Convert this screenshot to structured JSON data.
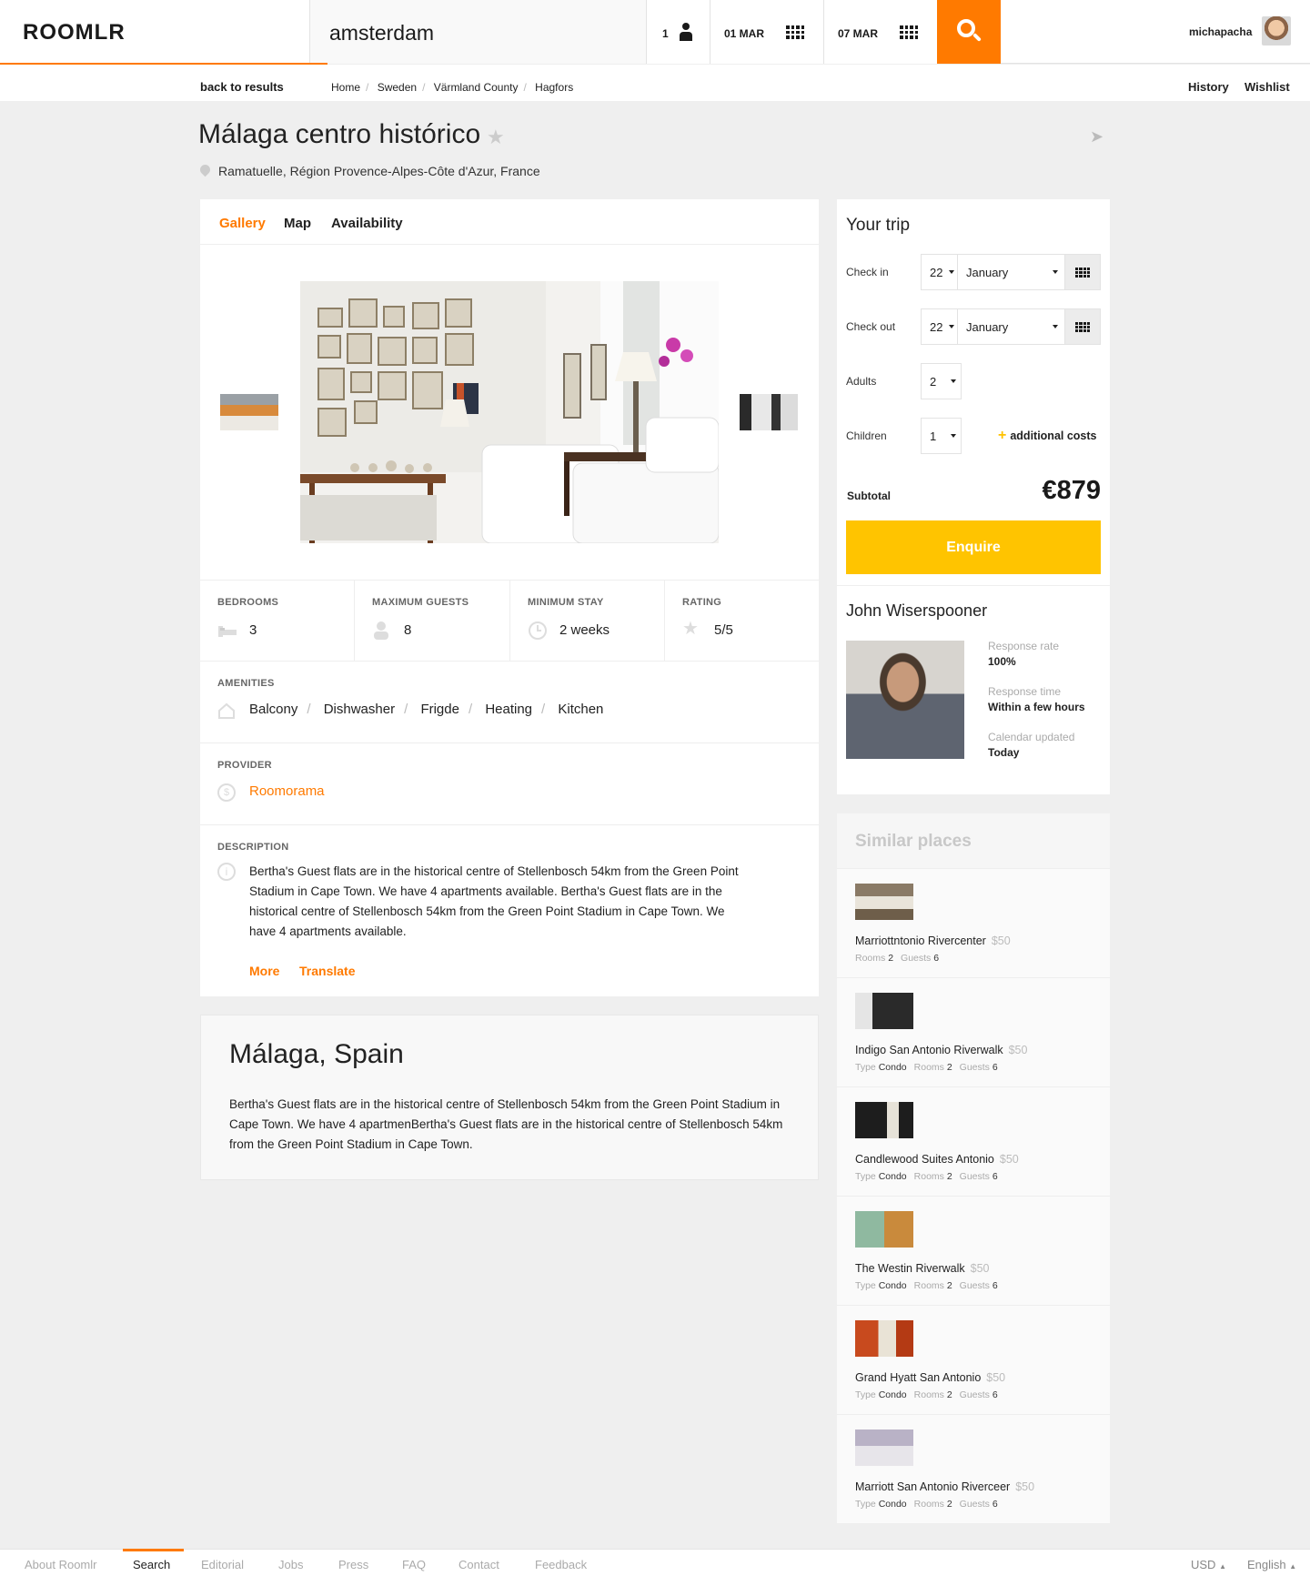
{
  "header": {
    "logo": "ROOMLR",
    "search_value": "amsterdam",
    "guests": "1",
    "checkin": "01 MAR",
    "checkout": "07 MAR",
    "username": "michapacha"
  },
  "subnav": {
    "back": "back to results",
    "breadcrumb": [
      "Home",
      "Sweden",
      "Värmland County",
      "Hagfors"
    ],
    "history": "History",
    "wishlist": "Wishlist"
  },
  "listing": {
    "title": "Málaga centro histórico",
    "location": "Ramatuelle, Région Provence-Alpes-Côte d'Azur, France",
    "tabs": [
      "Gallery",
      "Map",
      "Availability"
    ],
    "stats": [
      {
        "label": "BEDROOMS",
        "value": "3"
      },
      {
        "label": "MAXIMUM GUESTS",
        "value": "8"
      },
      {
        "label": "MINIMUM STAY",
        "value": "2 weeks"
      },
      {
        "label": "RATING",
        "value": "5/5"
      }
    ],
    "amenities_label": "AMENITIES",
    "amenities": [
      "Balcony",
      "Dishwasher",
      "Frigde",
      "Heating",
      "Kitchen"
    ],
    "provider_label": "PROVIDER",
    "provider": "Roomorama",
    "description_label": "DESCRIPTION",
    "description": "Bertha's Guest flats are in the historical centre of Stellenbosch 54km from the Green Point Stadium in Cape Town. We have 4 apartments available. Bertha's Guest flats are in the historical centre of Stellenbosch 54km from the Green Point Stadium in Cape Town. We have 4 apartments available.",
    "more": "More",
    "translate": "Translate"
  },
  "city": {
    "title": "Málaga, Spain",
    "text": "Bertha's Guest flats are in the historical centre of Stellenbosch 54km from the Green Point Stadium in Cape Town. We have 4 apartmenBertha's Guest flats are in the historical centre of Stellenbosch 54km from the Green Point Stadium in Cape Town."
  },
  "trip": {
    "title": "Your trip",
    "checkin_label": "Check in",
    "checkin_day": "22",
    "checkin_month": "January",
    "checkout_label": "Check out",
    "checkout_day": "22",
    "checkout_month": "January",
    "adults_label": "Adults",
    "adults": "2",
    "children_label": "Children",
    "children": "1",
    "additional": "additional costs",
    "subtotal_label": "Subtotal",
    "subtotal": "€879",
    "enquire": "Enquire"
  },
  "host": {
    "name": "John Wiserspooner",
    "response_rate_label": "Response rate",
    "response_rate": "100%",
    "response_time_label": "Response time",
    "response_time": "Within a few hours",
    "calendar_label": "Calendar updated",
    "calendar": "Today"
  },
  "similar": {
    "title": "Similar places",
    "items": [
      {
        "name": "Marriottntonio Rivercenter",
        "price": "$50",
        "type": "",
        "rooms": "2",
        "guests": "6"
      },
      {
        "name": "Indigo San Antonio Riverwalk",
        "price": "$50",
        "type": "Condo",
        "rooms": "2",
        "guests": "6"
      },
      {
        "name": "Candlewood Suites Antonio",
        "price": "$50",
        "type": "Condo",
        "rooms": "2",
        "guests": "6"
      },
      {
        "name": "The Westin Riverwalk",
        "price": "$50",
        "type": "Condo",
        "rooms": "2",
        "guests": "6"
      },
      {
        "name": "Grand Hyatt San Antonio",
        "price": "$50",
        "type": "Condo",
        "rooms": "2",
        "guests": "6"
      },
      {
        "name": "Marriott San Antonio Riverceer",
        "price": "$50",
        "type": "Condo",
        "rooms": "2",
        "guests": "6"
      }
    ],
    "type_label": "Type",
    "rooms_label": "Rooms",
    "guests_label": "Guests"
  },
  "footer": {
    "links": [
      "About Roomlr",
      "Search",
      "Editorial",
      "Jobs",
      "Press",
      "FAQ",
      "Contact",
      "Feedback"
    ],
    "currency": "USD",
    "language": "English"
  },
  "colors": {
    "accent": "#ff7a00",
    "enquire": "#ffc400"
  }
}
